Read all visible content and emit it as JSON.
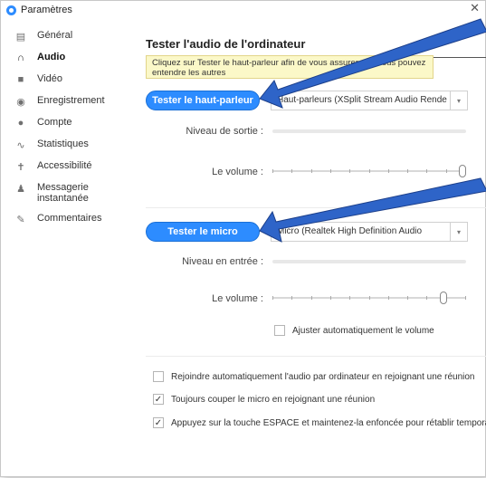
{
  "window": {
    "title": "Paramètres",
    "close_glyph": "✕"
  },
  "sidebar": {
    "items": [
      {
        "label": "Général",
        "icon": "general-icon",
        "glyph": "▤"
      },
      {
        "label": "Audio",
        "icon": "headphones-icon",
        "glyph": "∩",
        "active": true
      },
      {
        "label": "Vidéo",
        "icon": "video-icon",
        "glyph": "■"
      },
      {
        "label": "Enregistrement",
        "icon": "record-icon",
        "glyph": "◉"
      },
      {
        "label": "Compte",
        "icon": "account-icon",
        "glyph": "●"
      },
      {
        "label": "Statistiques",
        "icon": "stats-icon",
        "glyph": "∿"
      },
      {
        "label": "Accessibilité",
        "icon": "accessibility-icon",
        "glyph": "✝"
      },
      {
        "label": "Messagerie instantanée",
        "icon": "chat-icon",
        "glyph": "♟"
      },
      {
        "label": "Commentaires",
        "icon": "feedback-icon",
        "glyph": "✎"
      }
    ]
  },
  "main": {
    "title": "Tester l'audio de l'ordinateur",
    "tooltip": "Cliquez sur Tester le haut-parleur afin de vous assurer que vous pouvez entendre les autres",
    "speaker": {
      "test_button": "Tester le haut-parleur",
      "device": "Haut-parleurs (XSplit Stream Audio Rende",
      "output_level_label": "Niveau de sortie :",
      "volume_label": "Le volume :",
      "volume_value": 1.0
    },
    "mic": {
      "test_button": "Tester le micro",
      "device": "Micro (Realtek High Definition Audio",
      "input_level_label": "Niveau en entrée :",
      "volume_label": "Le volume :",
      "volume_value": 0.9,
      "auto_adjust_label": "Ajuster automatiquement le volume",
      "auto_adjust_checked": false
    },
    "options": [
      {
        "label": "Rejoindre automatiquement l'audio par ordinateur en rejoignant une réunion",
        "checked": false
      },
      {
        "label": "Toujours couper le micro en rejoignant une réunion",
        "checked": true
      },
      {
        "label": "Appuyez sur la touche ESPACE et maintenez-la enfoncée pour rétablir temporai",
        "checked": true
      }
    ]
  },
  "colors": {
    "accent": "#2d8cff",
    "annotation_arrow": "#2e64c8"
  }
}
